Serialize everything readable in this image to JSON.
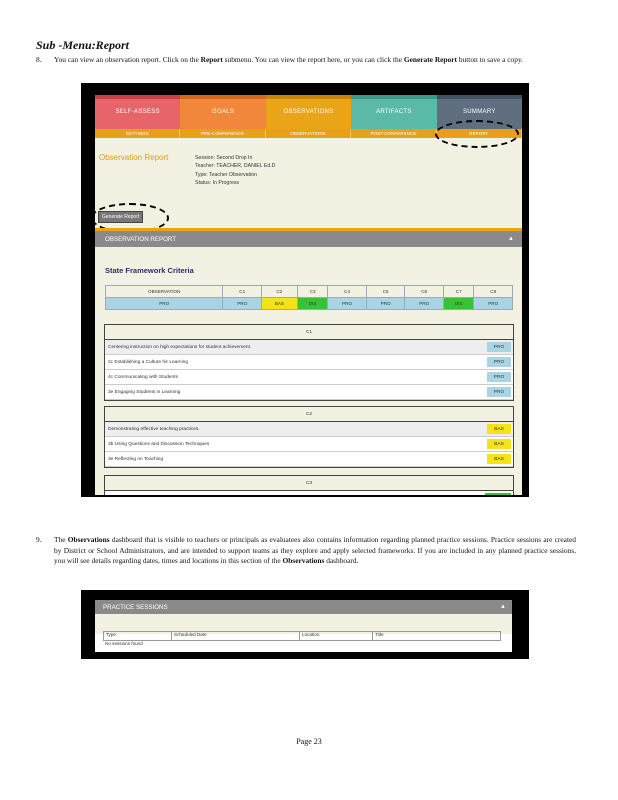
{
  "heading": "Sub -Menu:Report",
  "step8": {
    "num": "8.",
    "pre": "You can view an observation report. Click on the ",
    "b1": "Report",
    "mid": " submenu. You can view the report here, or you can click the ",
    "b2": "Generate Report",
    "post": " button to save a copy."
  },
  "step9": {
    "num": "9.",
    "pre": "The ",
    "b1": "Observations",
    "mid": " dashboard that is visible to teachers or principals as evaluatees also contains information regarding planned practice sessions. Practice sessions are created by District or School Administrators, and are intended to support teams as they explore and apply selected frameworks. If you are included in any planned practice sessions, you will see details regarding dates, times and locations in this section of the ",
    "b2": "Observations",
    "post": " dashboard."
  },
  "tabs": [
    {
      "label": "SELF-ASSESS",
      "color": "#e8646b",
      "bar": "#c93f46"
    },
    {
      "label": "GOALS",
      "color": "#f0873a",
      "bar": "#d6661b"
    },
    {
      "label": "OBSERVATIONS",
      "color": "#e9a417",
      "bar": "#c8850a"
    },
    {
      "label": "ARTIFACTS",
      "color": "#5bb9a7",
      "bar": "#3d9886"
    },
    {
      "label": "SUMMARY",
      "color": "#5f6f7f",
      "bar": "#435262"
    }
  ],
  "subtabs": [
    "SETTINGS",
    "PRE-CONFERENCE",
    "OBSERVATIONS",
    "POST-CONFERENCE",
    "REPORT"
  ],
  "obs_report": {
    "title": "Observation Report",
    "session": "Session: Second Drop In",
    "teacher": "Teacher: TEACHER, DANIEL Ed.D",
    "type": "Type: Teacher Observation",
    "status": "Status: In Progress",
    "generate_btn": "Generate Report"
  },
  "section_title": "OBSERVATION REPORT",
  "sfc_title": "State Framework Criteria",
  "criteria_headers": [
    "OBSERVATION",
    "C1",
    "C2",
    "C3",
    "C4",
    "C5",
    "C6",
    "C7",
    "C8"
  ],
  "criteria_values": [
    "PRO",
    "PRO",
    "BAS",
    "DIS",
    "PRO",
    "PRO",
    "PRO",
    "DIS",
    "PRO"
  ],
  "value_colors": {
    "PRO": "#a9d4e3",
    "BAS": "#f5e317",
    "DIS": "#35c337"
  },
  "c1": {
    "title": "C1",
    "rows": [
      {
        "text": "Centering instruction on high expectations for student achievement.",
        "val": "PRO"
      },
      {
        "text": "2c Establishing a Culture for Learning",
        "val": "PRO"
      },
      {
        "text": "4c Communicating with Students",
        "val": "PRO"
      },
      {
        "text": "3e Engaging Students in Learning",
        "val": "PRO"
      }
    ]
  },
  "c2": {
    "title": "C2",
    "rows": [
      {
        "text": "Demonstrating effective teaching practices.",
        "val": "BAS"
      },
      {
        "text": "3b Using Questions and Discussion Techniques",
        "val": "BAS"
      },
      {
        "text": "3e Reflecting on Teaching",
        "val": "BAS"
      }
    ]
  },
  "c3": {
    "title": "C3"
  },
  "practice": {
    "title": "PRACTICE SESSIONS",
    "headers": [
      "Type",
      "Scheduled Date",
      "Location",
      "Title"
    ],
    "empty": "No sessions found"
  },
  "page_label": "Page 23"
}
